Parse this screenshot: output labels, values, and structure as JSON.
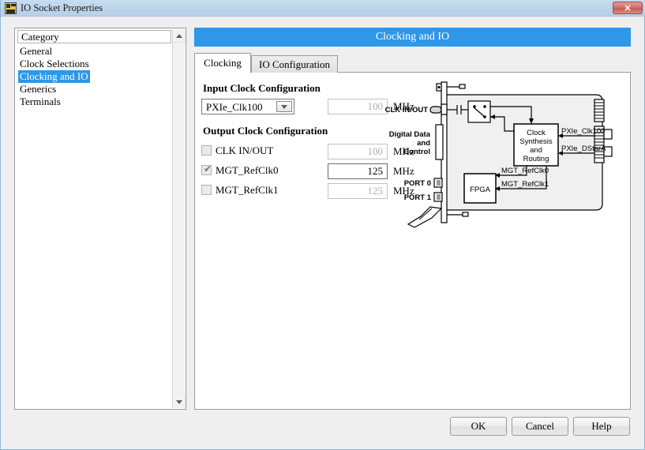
{
  "window": {
    "title": "IO Socket Properties",
    "icon": "labview-io-icon",
    "close_label": "✕",
    "accent_color": "#2e97e8",
    "titlebar_color": "#bdd4ea"
  },
  "category_panel": {
    "header": "Category",
    "items": [
      {
        "label": "General",
        "selected": false
      },
      {
        "label": "Clock Selections",
        "selected": false
      },
      {
        "label": "Clocking and IO",
        "selected": true
      },
      {
        "label": "Generics",
        "selected": false
      },
      {
        "label": "Terminals",
        "selected": false
      }
    ],
    "scrollbar": {
      "up": "scroll-up-arrow",
      "down": "scroll-down-arrow"
    }
  },
  "main": {
    "header": "Clocking and IO",
    "tabs": [
      {
        "label": "Clocking",
        "active": true
      },
      {
        "label": "IO Configuration",
        "active": false
      }
    ],
    "input_clock": {
      "title": "Input Clock Configuration",
      "source": "PXIe_Clk100",
      "frequency": "100",
      "unit": "MHz",
      "enabled": false
    },
    "output_clock": {
      "title": "Output Clock Configuration",
      "rows": [
        {
          "label": "CLK IN/OUT",
          "checked": false,
          "frequency": "100",
          "unit": "MHz",
          "enabled": false
        },
        {
          "label": "MGT_RefClk0",
          "checked": true,
          "frequency": "125",
          "unit": "MHz",
          "enabled": true
        },
        {
          "label": "MGT_RefClk1",
          "checked": false,
          "frequency": "125",
          "unit": "MHz",
          "enabled": false
        }
      ]
    }
  },
  "diagram": {
    "labels": {
      "clk_in_out": "CLK IN/OUT",
      "digital_1": "Digital Data",
      "digital_2": "and",
      "digital_3": "Control",
      "port0": "PORT 0",
      "port1": "PORT 1",
      "clock_block_1": "Clock",
      "clock_block_2": "Synthesis",
      "clock_block_3": "and",
      "clock_block_4": "Routing",
      "fpga": "FPGA",
      "pxie_clk100": "PXIe_Clk100",
      "pxie_dstara": "PXIe_DStarA",
      "mgt_refclk0": "MGT_RefClk0",
      "mgt_refclk1": "MGT_RefClk1"
    }
  },
  "buttons": {
    "ok": "OK",
    "cancel": "Cancel",
    "help": "Help"
  }
}
